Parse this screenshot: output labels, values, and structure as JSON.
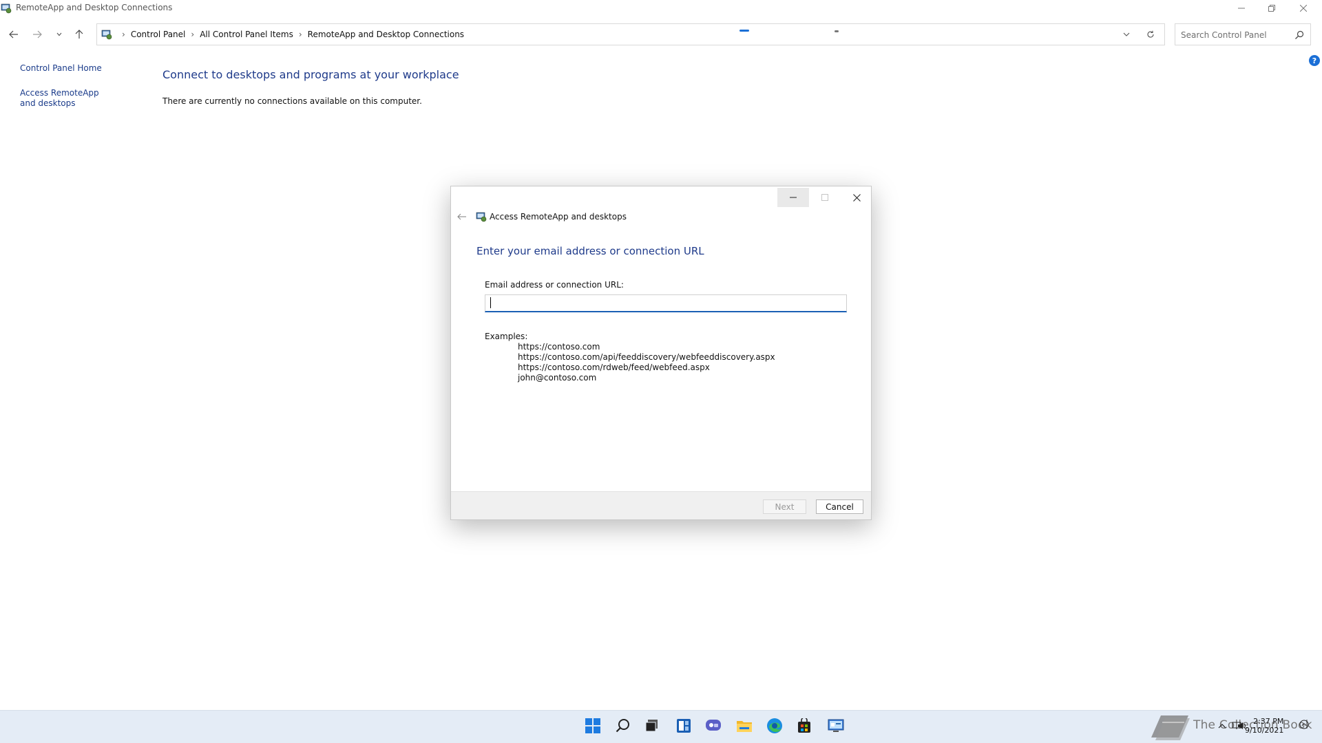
{
  "window": {
    "title": "RemoteApp and Desktop Connections"
  },
  "breadcrumb": {
    "items": [
      "Control Panel",
      "All Control Panel Items",
      "RemoteApp and Desktop Connections"
    ]
  },
  "search": {
    "placeholder": "Search Control Panel"
  },
  "help": {
    "label": "?"
  },
  "sidebar": {
    "items": [
      {
        "label": "Control Panel Home"
      },
      {
        "label": "Access RemoteApp and desktops"
      }
    ]
  },
  "main": {
    "title": "Connect to desktops and programs at your workplace",
    "message": "There are currently no connections available on this computer."
  },
  "dialog": {
    "title": "Access RemoteApp and desktops",
    "heading": "Enter your email address or connection URL",
    "field_label": "Email address or connection URL:",
    "field_value": "",
    "examples_label": "Examples:",
    "examples": [
      "https://contoso.com",
      "https://contoso.com/api/feeddiscovery/webfeeddiscovery.aspx",
      "https://contoso.com/rdweb/feed/webfeed.aspx",
      "john@contoso.com"
    ],
    "next_label": "Next",
    "cancel_label": "Cancel"
  },
  "taskbar": {
    "apps": [
      "start-icon",
      "search-icon",
      "task-view-icon",
      "widgets-icon",
      "chat-icon",
      "file-explorer-icon",
      "edge-icon",
      "store-icon",
      "control-panel-icon"
    ],
    "watermark": "The Collection Book",
    "clock_time": "2:37 PM",
    "clock_date": "9/10/2021"
  },
  "colors": {
    "heading_blue": "#1e3a8a",
    "accent_blue": "#1a5fb4",
    "taskbar_bg": "#e4ecf6"
  }
}
